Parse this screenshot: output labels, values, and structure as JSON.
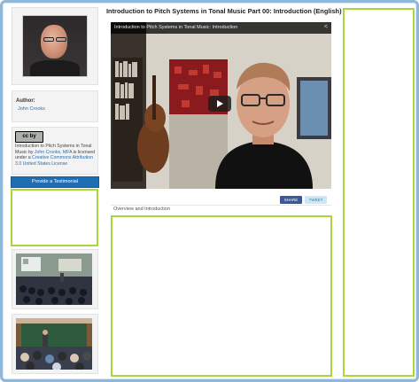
{
  "page": {
    "title": "Introduction to Pitch Systems in Tonal Music Part 00: Introduction (English)"
  },
  "author": {
    "label": "Author:",
    "name": "John Crooks"
  },
  "license": {
    "badge": "cc by",
    "text_prefix": "Introduction to Pitch Systems in Tonal Music by ",
    "author_link": "John Crooks, MFA",
    "text_mid": " is licensed under a ",
    "license_link": "Creative Commons Attribution 3.0 United States License"
  },
  "testimonial_button": "Provide a Testimonial",
  "video": {
    "title": "Introduction to Pitch Systems in Tonal Music: Introduction",
    "share_icon": "share-icon",
    "play_icon": "play-icon"
  },
  "share": {
    "facebook_label": "SHARE",
    "twitter_label": "TWEET"
  },
  "description": "Overview and Introduction",
  "colors": {
    "accent_green": "#a8d63b",
    "frame_blue": "#8fb8d8",
    "button_blue": "#1f6db3"
  }
}
